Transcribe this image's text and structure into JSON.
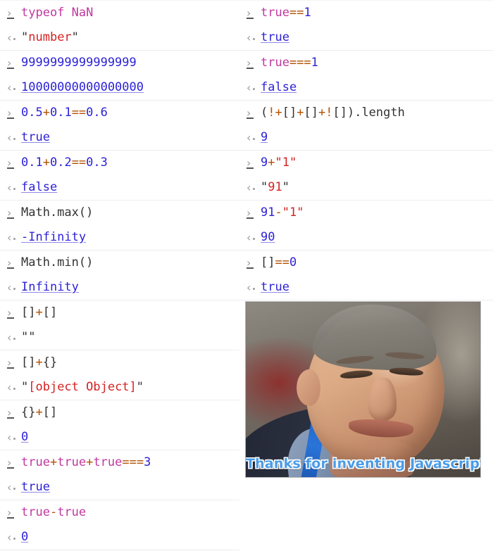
{
  "console": {
    "input_marker": "›",
    "output_marker": "‹",
    "left_column": [
      {
        "input_tokens": [
          {
            "t": "typeof ",
            "c": "t-kw"
          },
          {
            "t": "NaN",
            "c": "t-kw"
          }
        ],
        "input_text": "typeof NaN",
        "output_text": "\"number\"",
        "output_kind": "string"
      },
      {
        "input_tokens": [
          {
            "t": "9999999999999999",
            "c": "t-num"
          }
        ],
        "input_text": "9999999999999999",
        "output_text": "10000000000000000",
        "output_kind": "number"
      },
      {
        "input_tokens": [
          {
            "t": "0.5",
            "c": "t-num"
          },
          {
            "t": "+",
            "c": "t-op"
          },
          {
            "t": "0.1",
            "c": "t-num"
          },
          {
            "t": "==",
            "c": "t-op"
          },
          {
            "t": "0.6",
            "c": "t-num"
          }
        ],
        "input_text": "0.5+0.1==0.6",
        "output_text": "true",
        "output_kind": "bool"
      },
      {
        "input_tokens": [
          {
            "t": "0.1",
            "c": "t-num"
          },
          {
            "t": "+",
            "c": "t-op"
          },
          {
            "t": "0.2",
            "c": "t-num"
          },
          {
            "t": "==",
            "c": "t-op"
          },
          {
            "t": "0.3",
            "c": "t-num"
          }
        ],
        "input_text": "0.1+0.2==0.3",
        "output_text": "false",
        "output_kind": "bool"
      },
      {
        "input_tokens": [
          {
            "t": "Math.max()",
            "c": "t-ident"
          }
        ],
        "input_text": "Math.max()",
        "output_text": "-Infinity",
        "output_kind": "number"
      },
      {
        "input_tokens": [
          {
            "t": "Math.min()",
            "c": "t-ident"
          }
        ],
        "input_text": "Math.min()",
        "output_text": "Infinity",
        "output_kind": "number"
      },
      {
        "input_tokens": [
          {
            "t": "[]",
            "c": "t-punct"
          },
          {
            "t": "+",
            "c": "t-op"
          },
          {
            "t": "[]",
            "c": "t-punct"
          }
        ],
        "input_text": "[]+[]",
        "output_text": "\"\"",
        "output_kind": "string"
      },
      {
        "input_tokens": [
          {
            "t": "[]",
            "c": "t-punct"
          },
          {
            "t": "+",
            "c": "t-op"
          },
          {
            "t": "{}",
            "c": "t-punct"
          }
        ],
        "input_text": "[]+{}",
        "output_text": "\"[object Object]\"",
        "output_kind": "string"
      },
      {
        "input_tokens": [
          {
            "t": "{}",
            "c": "t-punct"
          },
          {
            "t": "+",
            "c": "t-op"
          },
          {
            "t": "[]",
            "c": "t-punct"
          }
        ],
        "input_text": "{}+[]",
        "output_text": "0",
        "output_kind": "number"
      },
      {
        "input_tokens": [
          {
            "t": "true",
            "c": "t-kw"
          },
          {
            "t": "+",
            "c": "t-op"
          },
          {
            "t": "true",
            "c": "t-kw"
          },
          {
            "t": "+",
            "c": "t-op"
          },
          {
            "t": "true",
            "c": "t-kw"
          },
          {
            "t": "===",
            "c": "t-op"
          },
          {
            "t": "3",
            "c": "t-num"
          }
        ],
        "input_text": "true+true+true===3",
        "output_text": "true",
        "output_kind": "bool"
      },
      {
        "input_tokens": [
          {
            "t": "true",
            "c": "t-kw"
          },
          {
            "t": "-",
            "c": "t-op"
          },
          {
            "t": "true",
            "c": "t-kw"
          }
        ],
        "input_text": "true-true",
        "output_text": "0",
        "output_kind": "number"
      }
    ],
    "right_column": [
      {
        "input_tokens": [
          {
            "t": "true",
            "c": "t-kw"
          },
          {
            "t": "==",
            "c": "t-op"
          },
          {
            "t": "1",
            "c": "t-num"
          }
        ],
        "input_text": "true==1",
        "output_text": "true",
        "output_kind": "bool"
      },
      {
        "input_tokens": [
          {
            "t": "true",
            "c": "t-kw"
          },
          {
            "t": "===",
            "c": "t-op"
          },
          {
            "t": "1",
            "c": "t-num"
          }
        ],
        "input_text": "true===1",
        "output_text": "false",
        "output_kind": "bool"
      },
      {
        "input_tokens": [
          {
            "t": "(",
            "c": "t-punct"
          },
          {
            "t": "!",
            "c": "t-op"
          },
          {
            "t": "+",
            "c": "t-op"
          },
          {
            "t": "[]",
            "c": "t-punct"
          },
          {
            "t": "+",
            "c": "t-op"
          },
          {
            "t": "[]",
            "c": "t-punct"
          },
          {
            "t": "+",
            "c": "t-op"
          },
          {
            "t": "!",
            "c": "t-op"
          },
          {
            "t": "[]",
            "c": "t-punct"
          },
          {
            "t": ")",
            "c": "t-punct"
          },
          {
            "t": ".length",
            "c": "t-ident"
          }
        ],
        "input_text": "(!+[]+[]+![]).length",
        "output_text": "9",
        "output_kind": "number"
      },
      {
        "input_tokens": [
          {
            "t": "9",
            "c": "t-num"
          },
          {
            "t": "+",
            "c": "t-op"
          },
          {
            "t": "\"1\"",
            "c": "t-str"
          }
        ],
        "input_text": "9+\"1\"",
        "output_text": "\"91\"",
        "output_kind": "string"
      },
      {
        "input_tokens": [
          {
            "t": "91",
            "c": "t-num"
          },
          {
            "t": "-",
            "c": "t-op"
          },
          {
            "t": "\"1\"",
            "c": "t-str"
          }
        ],
        "input_text": "91-\"1\"",
        "output_text": "90",
        "output_kind": "number"
      },
      {
        "input_tokens": [
          {
            "t": "[]",
            "c": "t-punct"
          },
          {
            "t": "==",
            "c": "t-op"
          },
          {
            "t": "0",
            "c": "t-num"
          }
        ],
        "input_text": "[]==0",
        "output_text": "true",
        "output_kind": "bool"
      }
    ]
  },
  "meme": {
    "caption": "Thanks for inventing Javascript",
    "alt": "Portrait photograph of a smiling middle-aged man wearing a dark suit and a blue conference lanyard"
  },
  "colors": {
    "keyword": "#c0399f",
    "number": "#2d22d6",
    "string": "#d42222",
    "operator": "#b35000",
    "identifier": "#333333",
    "marker": "#9b9b9b",
    "divider": "#ededed",
    "background": "#ffffff",
    "caption": "#4a9ce8"
  }
}
